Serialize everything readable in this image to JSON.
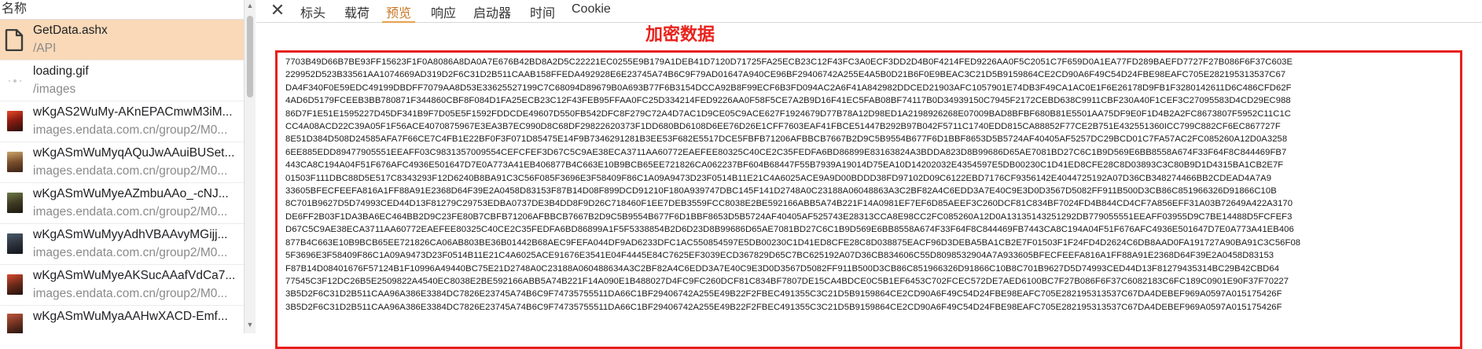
{
  "list": {
    "column_header": "名称",
    "items": [
      {
        "name": "GetData.ashx",
        "path": "/API",
        "icon": "document-icon",
        "selected": true
      },
      {
        "name": "loading.gif",
        "path": "/images",
        "icon": "gif-icon",
        "selected": false
      },
      {
        "name": "wKgAS2WuMy-AKnEPACmwM3iM...",
        "path": "images.endata.com.cn/group2/M0...",
        "icon": "image-thumbnail-icon",
        "selected": false
      },
      {
        "name": "wKgASmWuMyqAQuJwAAuiBUSet...",
        "path": "images.endata.com.cn/group2/M0...",
        "icon": "image-thumbnail-icon",
        "selected": false
      },
      {
        "name": "wKgASmWuMyeAZmbuAAo_-cNJ...",
        "path": "images.endata.com.cn/group2/M0...",
        "icon": "image-thumbnail-icon",
        "selected": false
      },
      {
        "name": "wKgASmWuMyyAdhVBAAvyMGijj...",
        "path": "images.endata.com.cn/group2/M0...",
        "icon": "image-thumbnail-icon",
        "selected": false
      },
      {
        "name": "wKgASmWuMyeAKSucAAafVdCa7...",
        "path": "images.endata.com.cn/group2/M0...",
        "icon": "image-thumbnail-icon",
        "selected": false
      },
      {
        "name": "wKgASmWuMyaAAHwXACD-Emf...",
        "path": "",
        "icon": "image-thumbnail-icon",
        "selected": false
      }
    ]
  },
  "tabs": [
    {
      "id": "close",
      "label": "✕"
    },
    {
      "id": "headers",
      "label": "标头"
    },
    {
      "id": "payload",
      "label": "载荷"
    },
    {
      "id": "preview",
      "label": "预览",
      "active": true
    },
    {
      "id": "response",
      "label": "响应"
    },
    {
      "id": "initiator",
      "label": "启动器"
    },
    {
      "id": "timing",
      "label": "时间"
    },
    {
      "id": "cookie",
      "label": "Cookie"
    }
  ],
  "annotation": "加密数据",
  "colors": {
    "selected_row": "#f9d9b8",
    "active_tab": "#c87520",
    "annotation_red": "#e8221b",
    "box_border": "#e6201c"
  },
  "preview_lines": [
    "7703B49D66B7BE93FF15623F1F0A8086A8DA0A7E676B42BD8A2D5C22221EC0255E9B179A1DEB41D7120D71725FA25ECB23C12F43FC3A0ECF3DD2D4B0F4214FED9226AA0F5C2051C7F659D0A1EA77FD289BAEFD7727F27B086F6F37C603E",
    "229952D523B33561AA1074669AD319D2F6C31D2B511CAAB158FFEDA492928E6E23745A74B6C9F79AD01647A940CE96BF29406742A255E4A5B0D21B6F0E9BEAC3C21D5B9159864CE2CD90A6F49C54D24FBE98EAFC705E282195313537C67",
    "DA4F340F0E59EDC49199DBDFF7079AA8D53E33625527199C7C68094D89679B0A693B77F6B3154DCCA92B8F99ECF6B3FD094AC2A6F41A842982DDCED21903AFC1057901E74DB3F49CA1AC0E1F6E26178D9FB1F3280142611D6C486CFD62F",
    "4AD6D5179FCEEB3BB780871F344860CBF8F084D1FA25ECB23C12F43FEB95FFAA0FC25D334214FED9226AA0F58F5CE7A2B9D16F41EC5FAB08BF74117B0D34939150C7945F2172CEBD638C9911CBF230A40F1CEF3C27095583D4CD29EC988",
    "86D7F1E51E1595227D45DF341B9F7D05E5F1592FDDCDE49607D550FB542DFC8F279C72A4D7AC1D9CE05C9ACE627F1924679D77B78A12D98ED1A2198926268E07009BAD8BFBF680B81E5501AA75DF9E0F1D4B2A2FC8673807F5952C11C1C",
    "CC4A08ACD22C39A05F1F56ACE4070875967E3EA3B7EC990D8C68DF29822620373F1DD680BD6108D6EE76D26E1CFF7603EAF41FBCE51447B292B97B042F5711C1740EDD815CA88852F77CE2B751E432551360ICC799C882CF6EC867727F",
    "8E51D384D508D24585AFA7F66CE7C4FB1E22BF0F3F071D85475E14F9B7346291281B3EE53F682E5517DCE5FBFB71206AFBBCB7667B2D9C5B9554B677F6D1BBF8653D5B5724AF40405AF5257DC29BCD01C7FA57AC2FC085260A12D0A3258",
    "6EE885EDD89477905551EEAFF03C9831357009554CEFCFEF3D67C5C9AE38ECA3711AA60772EAEFEE80325C40CE2C35FEDFA6BD86899E83163824A3BDDA823D8B99686D65AE7081BD27C6C1B9D569E6BB8558A674F33F64F8C844469FB7",
    "443CA8C194A04F51F676AFC4936E501647D7E0A773A41EB406877B4C663E10B9BCB65EE721826CA062237BF604B68447F55B7939A19014D75EA10D14202032E4354597E5DB00230C1D41ED8CFE28C8D03893C3C80B9D1D4315BA1CB2E7F",
    "01503F111DBC88D5E517C8343293F12D6240B8BA91C3C56F085F3696E3F58409F86C1A09A9473D23F0514B11E21C4A6025ACE9A9D00BDDD38FD97102D09C6122EBD7176CF9356142E4044725192A07D36CB348274466BB2CDEAD4A7A9",
    "33605BFECFEEFA816A1FF88A91E2368D64F39E2A0458D83153F87B14D08F899DCD91210F180A939747DBC145F141D2748A0C23188A06048863A3C2BF82A4C6EDD3A7E40C9E3D0D3567D5082FF911B500D3CB86C851966326D91866C10B",
    "8C701B9627D5D74993CED44D13F81279C29753EDBA0737DE3B4DD8F9D26C718460F1EE7DEB3559FCC8038E2BE592166ABB5A74B221F14A0981EF7EF6D85AEEF3C260DCF81C834BF7024FD4B844CD4CF7A856EFF31A03B72649A422A3170",
    "DE6FF2B03F1DA3BA6EC464BB2D9C23FE80B7CBFB71206AFBBCB7667B2D9C5B9554B677F6D1BBF8653D5B5724AF40405AF525743E28313CCA8E98CC2FC085260A12D0A13135143251292DB779055551EEAFF03955D9C7BE14488D5FCFEF3",
    "D67C5C9AE38ECA3711AA60772EAEFEE80325C40CE2C35FEDFA6BD86899A1F5F5338854B2D6D23D8B99686D65AE7081BD27C6C1B9D569E6BB8558A674F33F64F8C844469FB7443CA8C194A04F51F676AFC4936E501647D7E0A773A41EB406",
    "877B4C663E10B9BCB65EE721826CA06AB803BE36B01442B68AEC9FEFA044DF9AD6233DFC1AC550854597E5DB00230C1D41ED8CFE28C8D038875EACF96D3DEBA5BA1CB2E7F01503F1F24FD4D2624C6DB8AAD0FA191727A90BA91C3C56F08",
    "5F3696E3F58409F86C1A09A9473D23F0514B11E21C4A6025ACE91676E3541E04F4445E84C7625EF3039ECD367829D65C7BC625192A07D36CB834606C55D8098532904A7A933605BFECFEEFA816A1FF88A91E2368D64F39E2A0458D83153",
    "F87B14D08401676F57124B1F10996A49440BC75E21D2748A0C23188A060488634A3C2BF82A4C6EDD3A7E40C9E3D0D3567D5082FF911B500D3CB86C851966326D91866C10B8C701B9627D5D74993CED44D13F81279435314BC29B42CBD64",
    "77545C3F12DC26B5E2509822A4540EC8038E2BE592166ABB5A74B221F14A090E1B488027D4FC9FC260DCF81C834BF7807DE15CA4BDCE0C5B1EF6453C702FCEC572DE7AED6100BC7F27B086F6F37C6082183C6FC189C0901E90F37F70227",
    "3B5D2F6C31D2B511CAA96A386E3384DC7826E23745A74B6C9F74735755511DA66C1BF29406742A255E49B22F2FBEC491355C3C21D5B9159864CE2CD90A6F49C54D24FBE98EAFC705E282195313537C67DA4DEBEF969A0597A015175426F",
    "3B5D2F6C31D2B511CAA96A386E3384DC7826E23745A74B6C9F74735755511DA66C1BF29406742A255E49B22F2FBEC491355C3C21D5B9159864CE2CD90A6F49C54D24FBE98EAFC705E282195313537C67DA4DEBEF969A0597A015175426F"
  ]
}
